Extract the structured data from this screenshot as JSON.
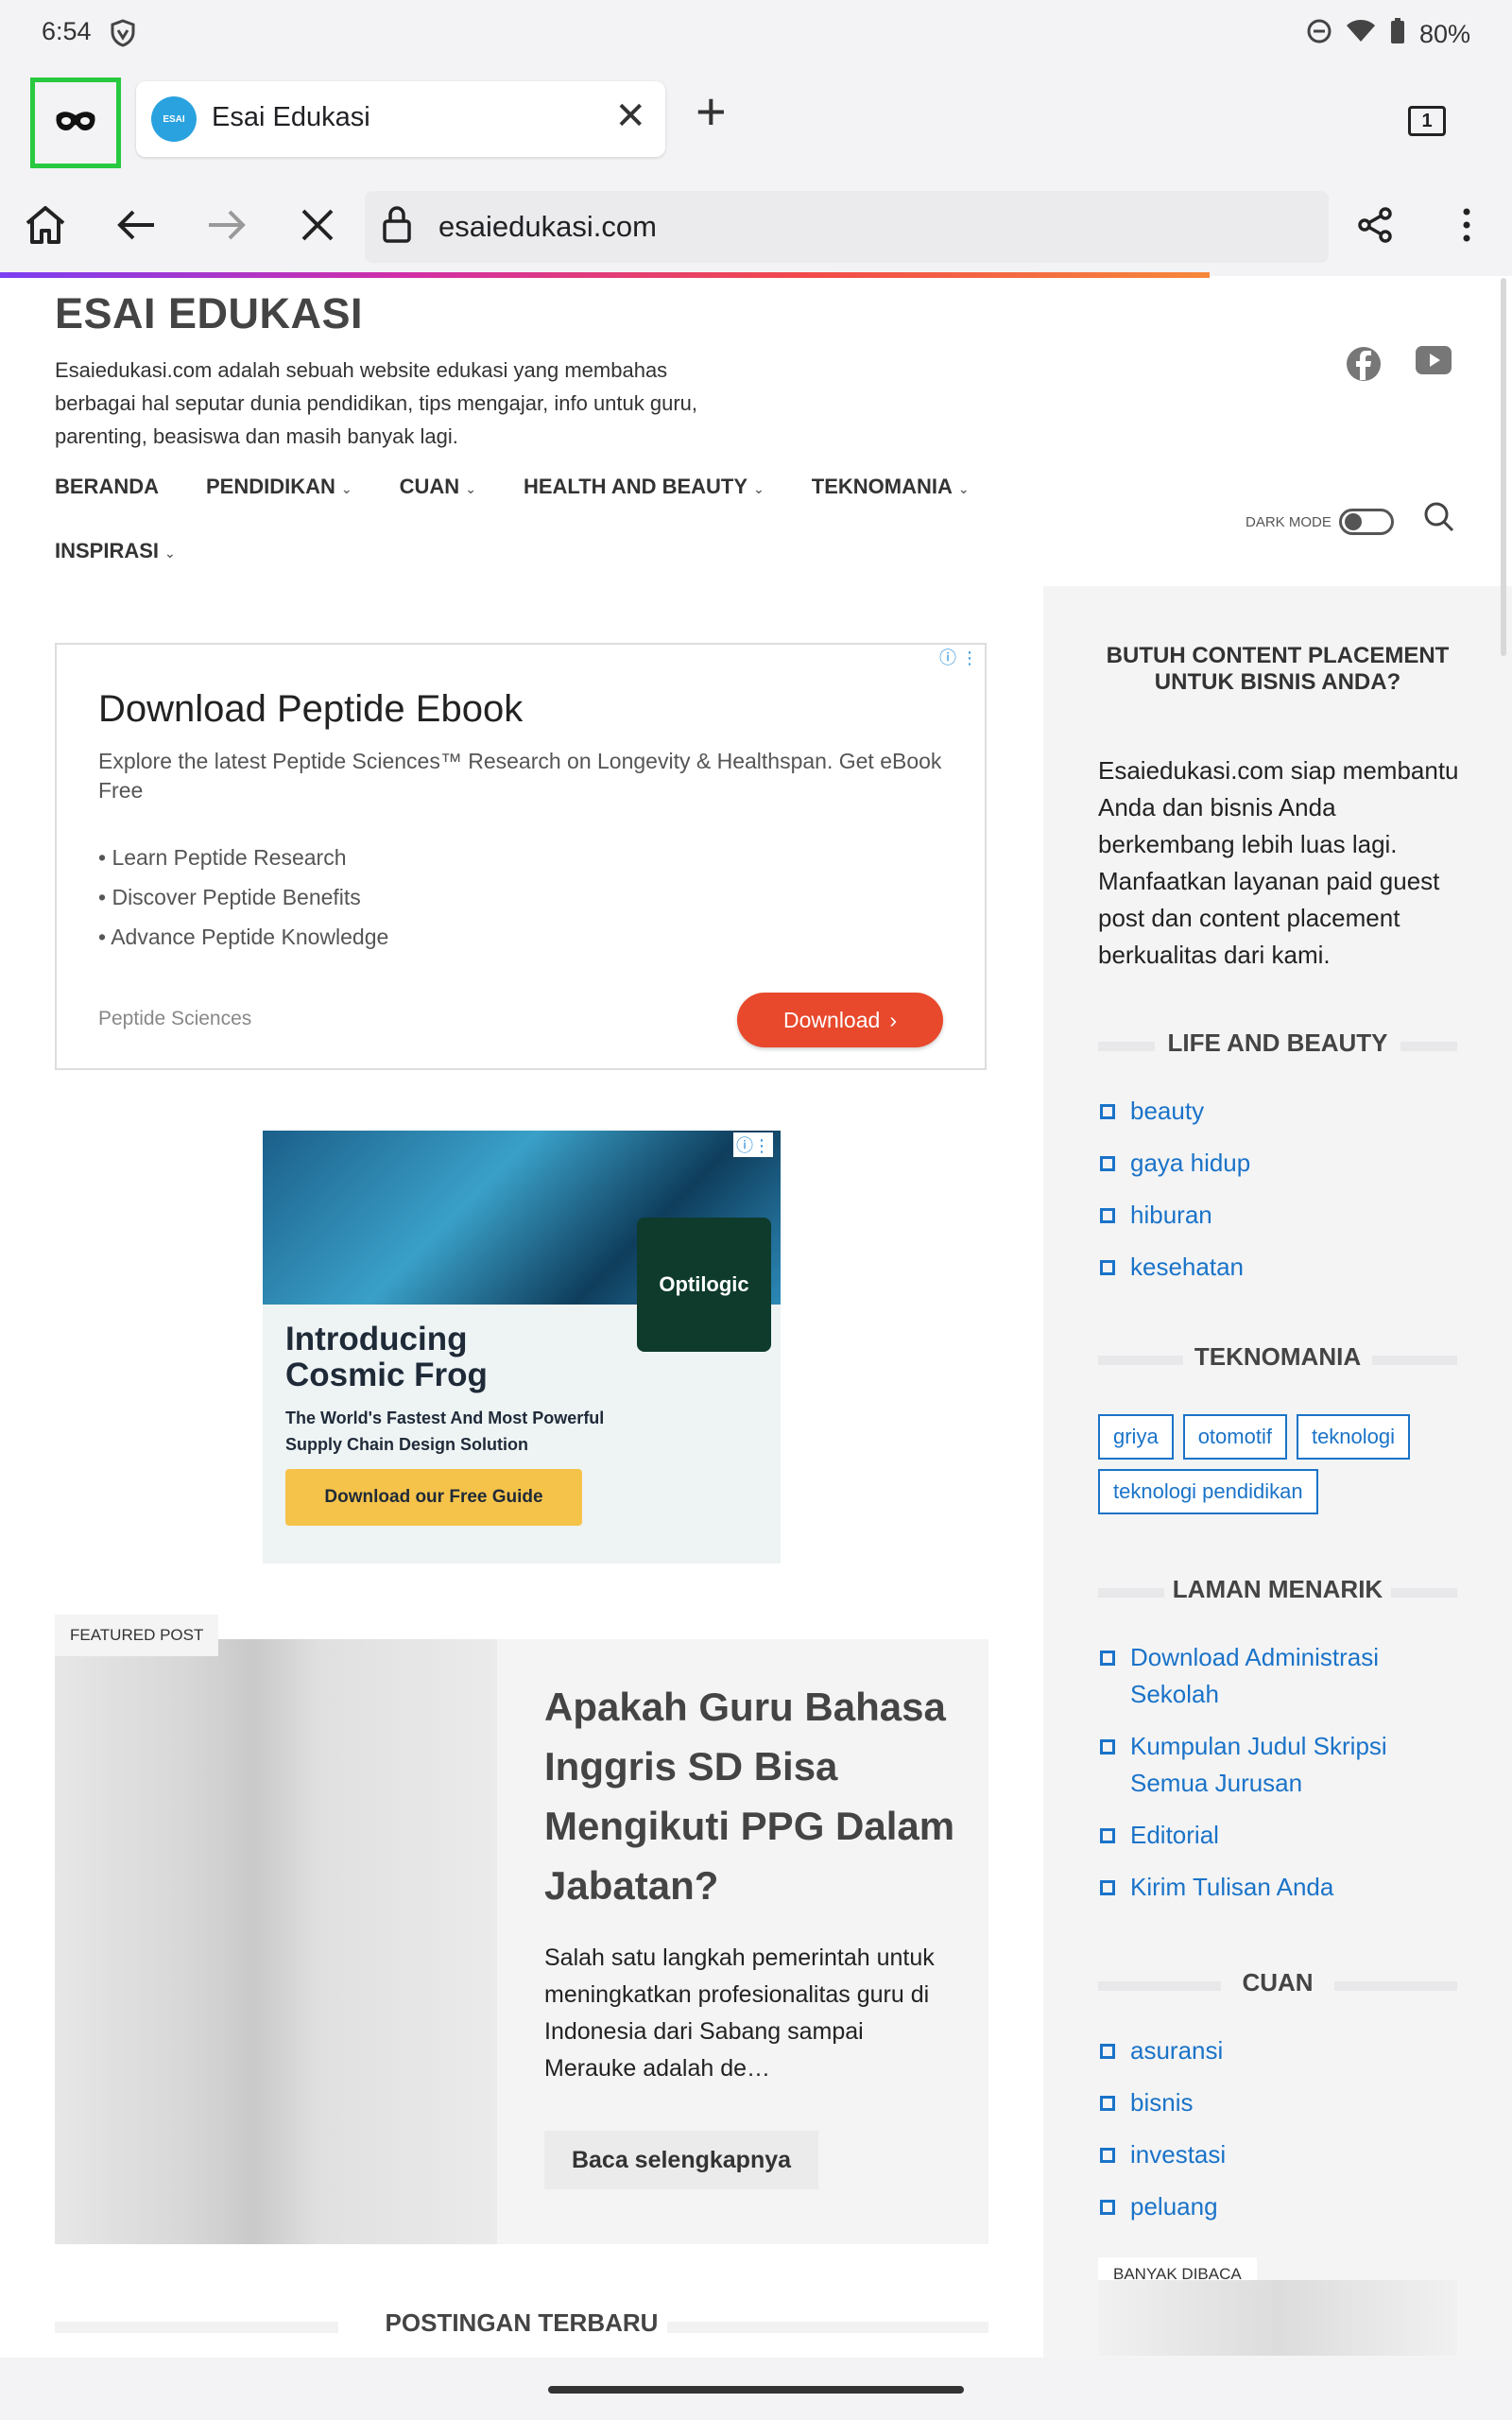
{
  "status": {
    "time": "6:54",
    "battery": "80%"
  },
  "tabs": {
    "active_title": "Esai Edukasi",
    "favicon_text": "ESAI",
    "count": "1"
  },
  "toolbar": {
    "url": "esaiedukasi.com"
  },
  "site": {
    "title": "ESAI EDUKASI",
    "description": "Esaiedukasi.com adalah sebuah website edukasi yang membahas berbagai hal seputar dunia pendidikan, tips mengajar, info untuk guru, parenting, beasiswa dan masih banyak lagi.",
    "dark_mode_label": "DARK MODE"
  },
  "nav": {
    "items": [
      "BERANDA",
      "PENDIDIKAN",
      "CUAN",
      "HEALTH AND BEAUTY",
      "TEKNOMANIA"
    ],
    "second_row": "INSPIRASI"
  },
  "ad1": {
    "headline": "Download Peptide Ebook",
    "description": "Explore the latest Peptide Sciences™ Research on Longevity & Healthspan. Get eBook Free",
    "bullets": [
      "Learn Peptide Research",
      "Discover Peptide Benefits",
      "Advance Peptide Knowledge"
    ],
    "brand": "Peptide Sciences",
    "button": "Download"
  },
  "ad2": {
    "logo": "Optilogic",
    "headline_1": "Introducing",
    "headline_2": "Cosmic Frog",
    "subtext_1": "The World's Fastest And Most Powerful",
    "subtext_2": "Supply Chain Design Solution",
    "button": "Download our Free Guide"
  },
  "featured": {
    "label": "FEATURED POST",
    "title": "Apakah Guru Bahasa Inggris SD Bisa Mengikuti PPG Dalam Jabatan?",
    "excerpt": "Salah satu langkah pemerintah untuk meningkatkan profesionalitas guru di Indonesia dari Sabang sampai Merauke adalah de…",
    "button": "Baca selengkapnya"
  },
  "latest_heading": "POSTINGAN TERBARU",
  "sidebar": {
    "promo_title": "BUTUH CONTENT PLACEMENT UNTUK BISNIS ANDA?",
    "promo_text": "Esaiedukasi.com siap membantu Anda dan bisnis Anda berkembang lebih luas lagi. Manfaatkan layanan paid guest post dan content placement berkualitas dari kami.",
    "life_title": "LIFE AND BEAUTY",
    "life_items": [
      "beauty",
      "gaya hidup",
      "hiburan",
      "kesehatan"
    ],
    "tekno_title": "TEKNOMANIA",
    "tekno_tags": [
      "griya",
      "otomotif",
      "teknologi",
      "teknologi pendidikan"
    ],
    "laman_title": "LAMAN MENARIK",
    "laman_items": [
      "Download Administrasi Sekolah",
      "Kumpulan Judul Skripsi Semua Jurusan",
      "Editorial",
      "Kirim Tulisan Anda"
    ],
    "cuan_title": "CUAN",
    "cuan_items": [
      "asuransi",
      "bisnis",
      "investasi",
      "peluang"
    ],
    "banyak_label": "BANYAK DIBACA"
  }
}
